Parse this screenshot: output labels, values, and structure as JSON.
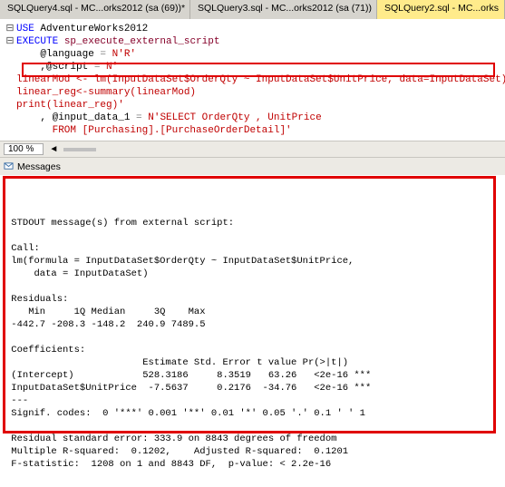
{
  "tabs": [
    {
      "label": "SQLQuery4.sql - MC...orks2012 (sa (69))*"
    },
    {
      "label": "SQLQuery3.sql - MC...orks2012 (sa (71))"
    },
    {
      "label": "SQLQuery2.sql - MC...orks"
    }
  ],
  "code": {
    "l1a": "USE",
    "l1b": " AdventureWorks2012",
    "l2a": "EXECUTE",
    "l2b": " sp_execute_external_script",
    "l3a": "    @language ",
    "l3b": "=",
    "l3c": " N'R'",
    "l4a": "    ,@script ",
    "l4b": "=",
    "l4c": " N'",
    "l5": "linearMod <- lm(InputDataSet$OrderQty ~ InputDataSet$UnitPrice, data=InputDataSet)",
    "l6": "linear_reg<-summary(linearMod)",
    "l7": "print(linear_reg)'",
    "l8a": "    , @input_data_1 ",
    "l8b": "=",
    "l8c": " N'SELECT OrderQty , UnitPrice",
    "l9": "      FROM [Purchasing].[PurchaseOrderDetail]'"
  },
  "zoom": "100 %",
  "messages_label": "Messages",
  "output_lines": [
    " STDOUT message(s) from external script:",
    "",
    " Call:",
    " lm(formula = InputDataSet$OrderQty ~ InputDataSet$UnitPrice, ",
    "     data = InputDataSet)",
    "",
    " Residuals:",
    "    Min     1Q Median     3Q    Max ",
    " -442.7 -208.3 -148.2  240.9 7489.5 ",
    "",
    " Coefficients:",
    "                        Estimate Std. Error t value Pr(>|t|)    ",
    " (Intercept)            528.3186     8.3519   63.26   <2e-16 ***",
    " InputDataSet$UnitPrice  -7.5637     0.2176  -34.76   <2e-16 ***",
    " ---",
    " Signif. codes:  0 '***' 0.001 '**' 0.01 '*' 0.05 '.' 0.1 ' ' 1",
    "",
    " Residual standard error: 333.9 on 8843 degrees of freedom",
    " Multiple R-squared:  0.1202,    Adjusted R-squared:  0.1201 ",
    " F-statistic:  1208 on 1 and 8843 DF,  p-value: < 2.2e-16"
  ]
}
